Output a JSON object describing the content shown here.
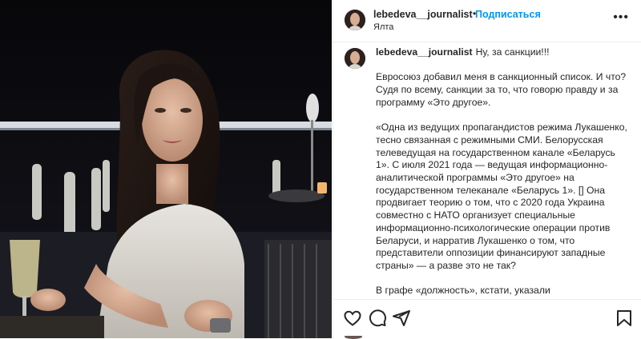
{
  "post": {
    "username": "lebedeva__journalist",
    "follow_label": "Подписаться",
    "separator": "•",
    "location": "Ялта",
    "more_label": "•••"
  },
  "caption": {
    "username": "lebedeva__journalist",
    "paragraphs": [
      "Ну, за санкции!!!",
      "Евросоюз добавил меня в санкционный список. И что? Судя по всему, санкции за то, что говорю правду и за программу «Это другое».",
      "«Одна из ведущих пропагандистов режима Лукашенко, тесно связанная с режимными СМИ. Белорусская телеведущая на государственном канале «Беларусь 1». С июля 2021 года — ведущая информационно-аналитической программы «Это другое» на государственном телеканале «Беларусь 1». [] Она продвигает теорию о том, что с 2020 года Украина совместно с НАТО организует специальные информационно-психологические операции против Беларуси, и нарратив Лукашенко о том, что представители оппозиции финансируют западные страны» — а разве это не так?",
      "В графе «должность», кстати, указали «пропагандистка» — просто очень странная должность. В целом, я не против."
    ]
  },
  "actions": {
    "like_icon": "heart-outline-icon",
    "comment_icon": "comment-bubble-icon",
    "share_icon": "paper-plane-icon",
    "save_icon": "bookmark-icon"
  },
  "colors": {
    "accent": "#0095f6",
    "text": "#262626",
    "divider": "#efefef"
  }
}
